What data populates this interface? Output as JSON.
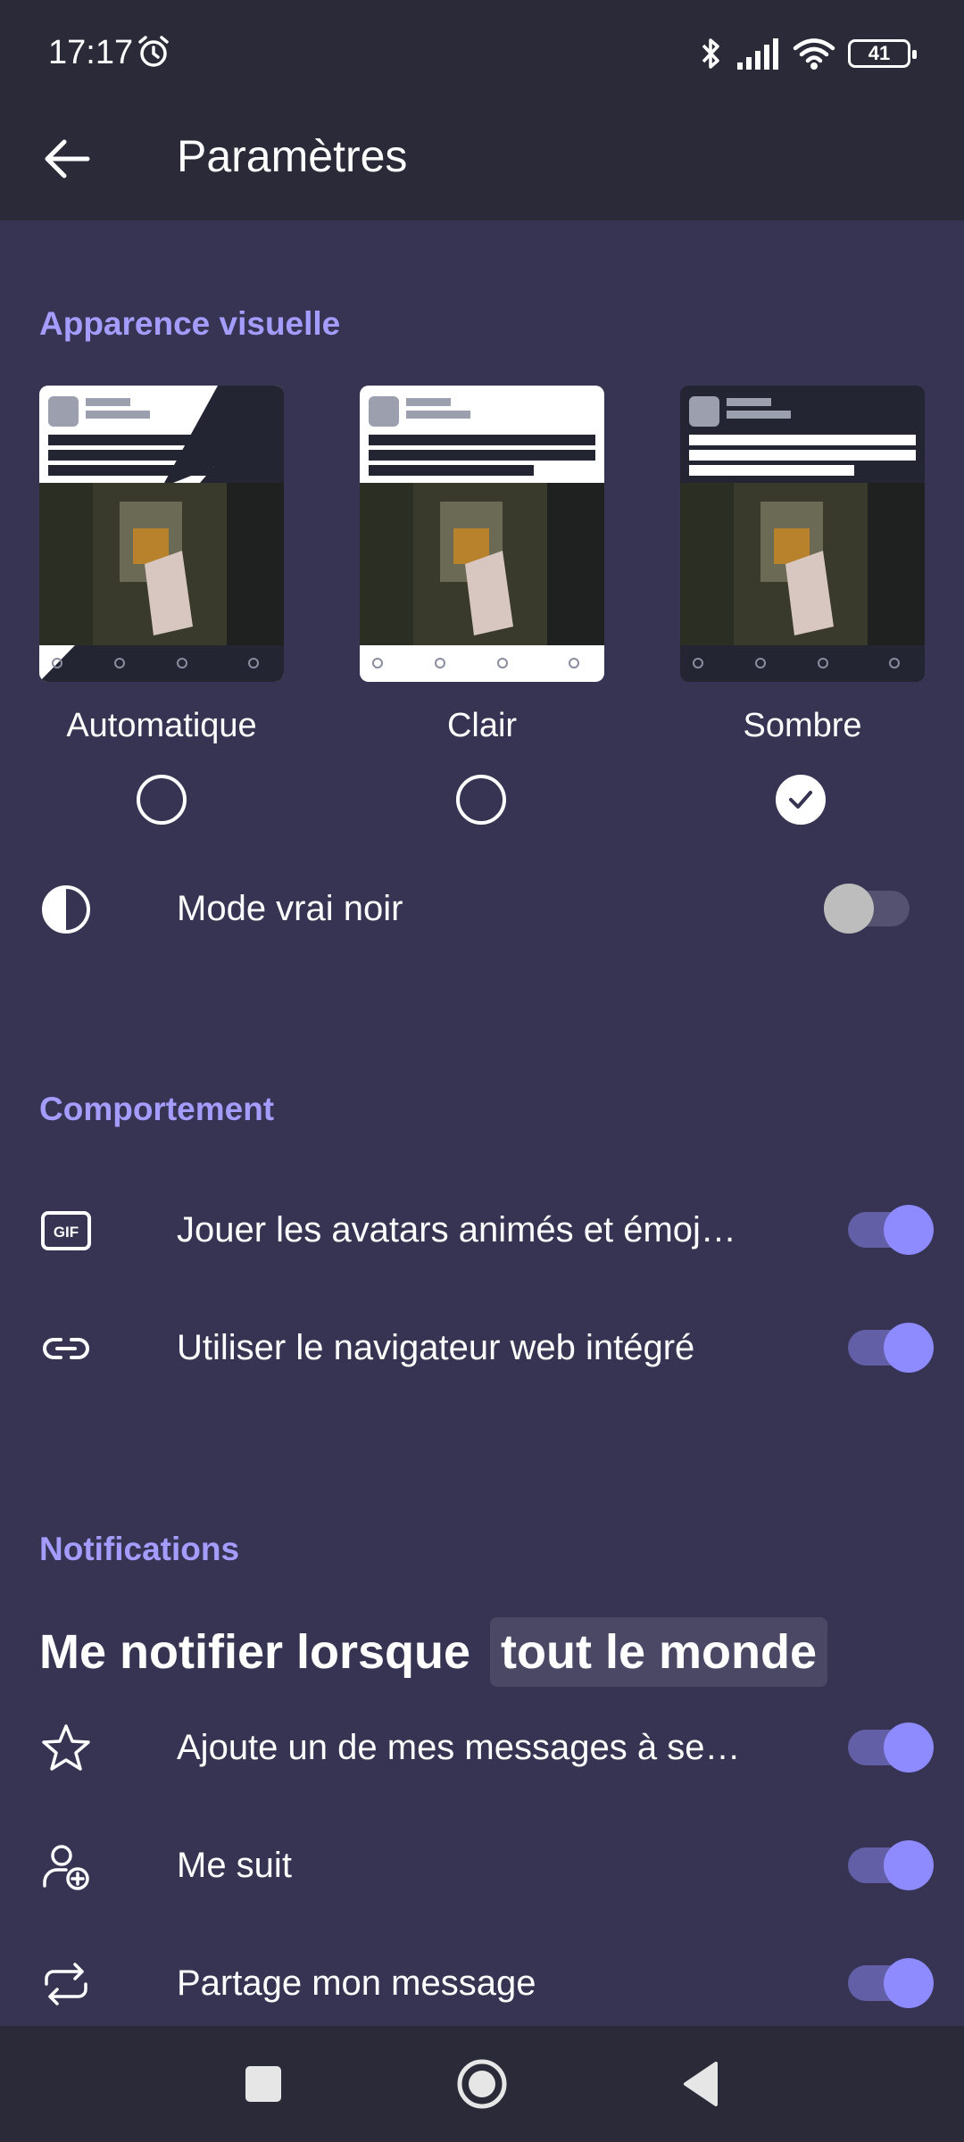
{
  "status": {
    "time": "17:17",
    "battery": "41"
  },
  "header": {
    "title": "Paramètres"
  },
  "appearance": {
    "section_title": "Apparence visuelle",
    "themes": [
      {
        "label": "Automatique",
        "selected": false
      },
      {
        "label": "Clair",
        "selected": false
      },
      {
        "label": "Sombre",
        "selected": true
      }
    ],
    "true_black": {
      "label": "Mode vrai noir",
      "enabled": false
    }
  },
  "behavior": {
    "section_title": "Comportement",
    "items": [
      {
        "label": "Jouer les avatars animés et émoj…",
        "enabled": true
      },
      {
        "label": "Utiliser le navigateur web intégré",
        "enabled": true
      }
    ]
  },
  "notifications": {
    "section_title": "Notifications",
    "notify_prefix": "Me notifier lorsque",
    "notify_scope": "tout le monde",
    "items": [
      {
        "label": "Ajoute un de mes messages à se…",
        "enabled": true
      },
      {
        "label": "Me suit",
        "enabled": true
      },
      {
        "label": "Partage mon message",
        "enabled": true
      }
    ]
  },
  "colors": {
    "background": "#363452",
    "bar": "#2b2a39",
    "accent": "#a59cff",
    "toggle_on": "#8e8aff"
  },
  "icons": [
    "alarm-icon",
    "bluetooth-icon",
    "signal-icon",
    "wifi-icon",
    "battery-icon",
    "back-arrow-icon",
    "contrast-icon",
    "gif-icon",
    "link-icon",
    "star-icon",
    "user-add-icon",
    "repeat-icon",
    "square-icon",
    "circle-icon",
    "triangle-back-icon"
  ]
}
